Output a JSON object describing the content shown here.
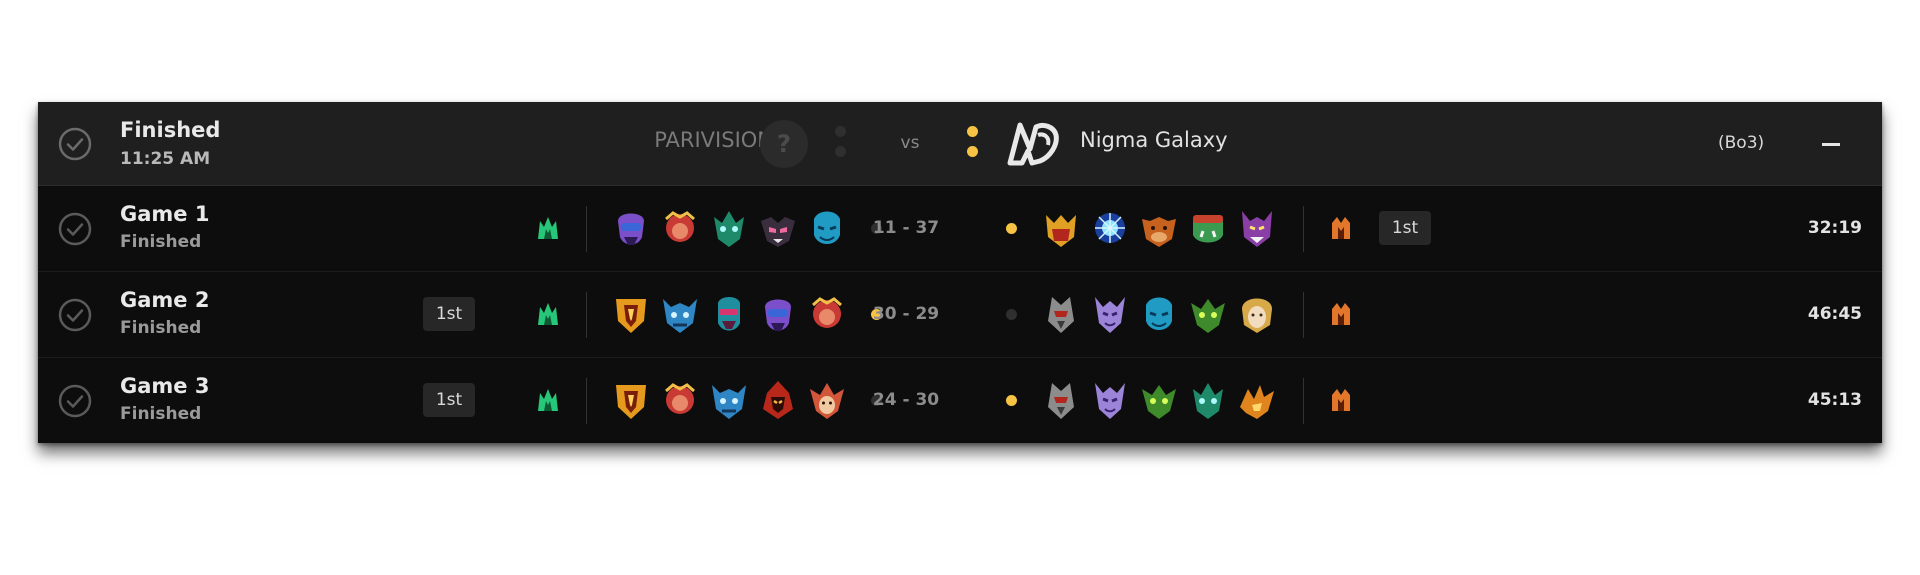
{
  "match": {
    "status": "Finished",
    "time": "11:25 AM",
    "team_left": "PARIVISION",
    "team_left_logo": "question-mark",
    "vs": "vs",
    "team_right": "Nigma Galaxy",
    "series_format": "(Bo3)",
    "series_score_left": 0,
    "series_score_right": 2,
    "collapse_icon": "minus-icon"
  },
  "colors": {
    "win_dot": "#f6c344",
    "off_dot": "#2f2f2f",
    "radiant_icon": "#27c77a",
    "dire_icon": "#e2762b"
  },
  "games": [
    {
      "title": "Game 1",
      "status": "Finished",
      "first_blood_left": "",
      "first_blood_right": "1st",
      "score": "11 - 37",
      "winner": "right",
      "duration": "32:19",
      "left_side_icon": "radiant-icon",
      "right_side_icon": "dire-icon",
      "left_heroes": [
        "hero-purple-hood",
        "hero-red-monkey",
        "hero-green-beast",
        "hero-pink-mask",
        "hero-blue-water"
      ],
      "right_heroes": [
        "hero-gold-horned",
        "hero-blue-energy",
        "hero-orange-bull",
        "hero-green-orc",
        "hero-purple-demon"
      ]
    },
    {
      "title": "Game 2",
      "status": "Finished",
      "first_blood_left": "1st",
      "first_blood_right": "",
      "score": "30 - 29",
      "winner": "left",
      "duration": "46:45",
      "left_side_icon": "radiant-icon",
      "right_side_icon": "dire-icon",
      "left_heroes": [
        "hero-flame-shield",
        "hero-blue-horned",
        "hero-teal-ranger",
        "hero-purple-hood",
        "hero-red-monkey"
      ],
      "right_heroes": [
        "hero-grey-knight",
        "hero-purple-spirit",
        "hero-blue-water",
        "hero-green-insect",
        "hero-gold-lady"
      ]
    },
    {
      "title": "Game 3",
      "status": "Finished",
      "first_blood_left": "1st",
      "first_blood_right": "",
      "score": "24 - 30",
      "winner": "right",
      "duration": "45:13",
      "left_side_icon": "radiant-icon",
      "right_side_icon": "dire-icon",
      "left_heroes": [
        "hero-flame-shield",
        "hero-red-monkey",
        "hero-blue-horned",
        "hero-fire-demon",
        "hero-red-elf"
      ],
      "right_heroes": [
        "hero-grey-knight",
        "hero-purple-spirit",
        "hero-green-insect",
        "hero-green-beast",
        "hero-orange-phoenix"
      ]
    }
  ]
}
